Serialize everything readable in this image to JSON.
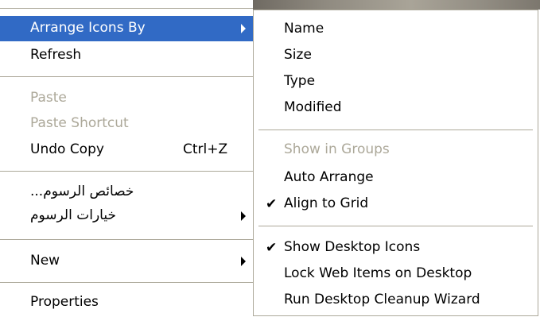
{
  "context_menu": {
    "items": [
      {
        "label": "Arrange Icons By",
        "submenu": true,
        "highlighted": true
      },
      {
        "label": "Refresh"
      },
      {
        "label": "Paste",
        "disabled": true
      },
      {
        "label": "Paste Shortcut",
        "disabled": true
      },
      {
        "label": "Undo Copy",
        "shortcut": "Ctrl+Z"
      },
      {
        "label": "خصائص الرسوم..."
      },
      {
        "label": "خيارات الرسوم",
        "submenu": true
      },
      {
        "label": "New",
        "submenu": true
      },
      {
        "label": "Properties"
      }
    ]
  },
  "arrange_submenu": {
    "items": [
      {
        "label": "Name"
      },
      {
        "label": "Size"
      },
      {
        "label": "Type"
      },
      {
        "label": "Modified"
      },
      {
        "label": "Show in Groups",
        "disabled": true
      },
      {
        "label": "Auto Arrange"
      },
      {
        "label": "Align to Grid",
        "checked": true
      },
      {
        "label": "Show Desktop Icons",
        "checked": true
      },
      {
        "label": "Lock Web Items on Desktop"
      },
      {
        "label": "Run Desktop Cleanup Wizard"
      }
    ],
    "check_glyph": "✔"
  },
  "colors": {
    "highlight": "#316ac5",
    "disabled_text": "#aca899",
    "separator": "#aca899"
  }
}
